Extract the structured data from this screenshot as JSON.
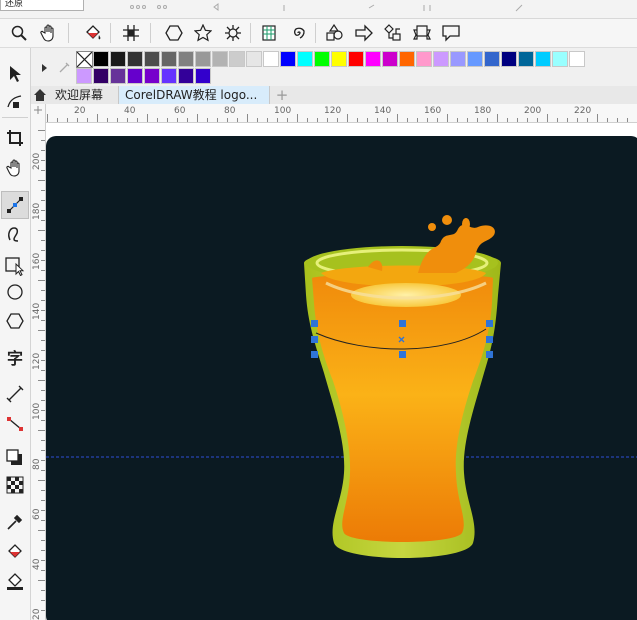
{
  "top_bar": {
    "combo_value": "还原"
  },
  "toolbar": {
    "icons": [
      "zoom-icon",
      "pan-hand-icon",
      "interactive-fill-icon",
      "snap-grid-icon",
      "polygon-icon",
      "star-icon",
      "complex-star-icon",
      "graph-paper-icon",
      "spiral-icon",
      "basic-shapes-icon",
      "arrow-shapes-icon",
      "flowchart-shapes-icon",
      "banner-shapes-icon",
      "callout-shapes-icon"
    ]
  },
  "toolbox": {
    "tools": [
      "pick-tool-icon",
      "shape-tool-icon",
      "crop-tool-icon",
      "pan-tool-icon",
      "freehand-tool-icon",
      "artistic-media-icon",
      "rectangle-tool-icon",
      "ellipse-tool-icon",
      "polygon-tool-icon",
      "text-tool-icon",
      "dimension-tool-icon",
      "connector-tool-icon",
      "drop-shadow-icon",
      "transparency-icon",
      "eyedropper-icon",
      "interactive-fill-tool-icon",
      "smart-fill-icon"
    ]
  },
  "palette": {
    "row1": [
      "#000000",
      "#1a1a1a",
      "#333333",
      "#4d4d4d",
      "#666666",
      "#808080",
      "#999999",
      "#b3b3b3",
      "#cccccc",
      "#e6e6e6",
      "#ffffff",
      "#0000ff",
      "#00ffff",
      "#00ff00",
      "#ffff00",
      "#ff0000",
      "#ff00ff",
      "#cc00cc",
      "#ff6600",
      "#ff99cc",
      "#cc99ff",
      "#9999ff",
      "#6699ff",
      "#3366cc",
      "#000080",
      "#006699",
      "#00ccff",
      "#99ffff",
      "#ffffff"
    ],
    "row2": [
      "#cc99ff",
      "#330066",
      "#663399",
      "#6600cc",
      "#7700cc",
      "#6633ff",
      "#330099",
      "#3300cc"
    ]
  },
  "tabs": {
    "welcome": "欢迎屏幕",
    "document": "CorelDRAW教程 logo...",
    "add": "+"
  },
  "hruler": {
    "labels": [
      "20",
      "40",
      "60",
      "80",
      "100",
      "120",
      "140",
      "160",
      "180",
      "200",
      "220"
    ]
  },
  "vruler": {
    "labels": [
      "200",
      "180",
      "160",
      "140",
      "120",
      "100",
      "80",
      "60",
      "40",
      "20"
    ]
  },
  "colors": {
    "canvas_bg": "#0b1a22",
    "glass_rim": "#a6c11e",
    "beer": "#f59a11",
    "handle": "#2f74d8"
  }
}
